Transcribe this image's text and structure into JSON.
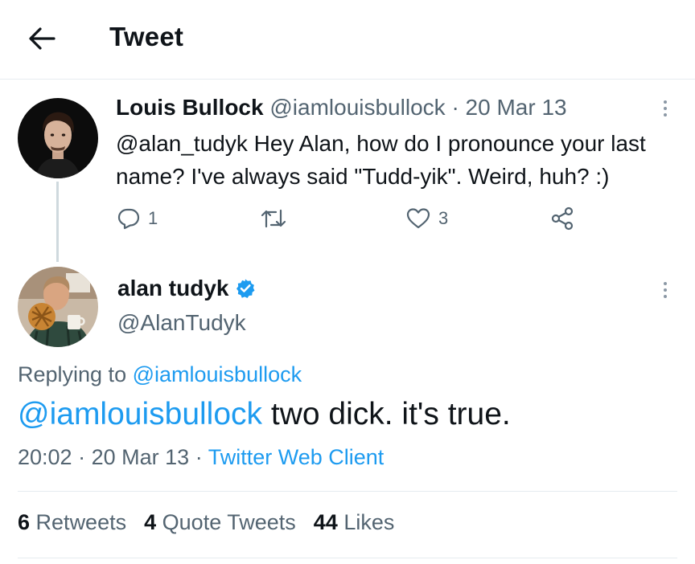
{
  "header": {
    "title": "Tweet"
  },
  "reply_tweet": {
    "author_name": "Louis Bullock",
    "handle": "@iamlouisbullock",
    "separator": "·",
    "date": "20 Mar 13",
    "text": "@alan_tudyk Hey Alan, how do I pronounce your last name? I've always said \"Tudd-yik\". Weird, huh? :)",
    "reply_count": "1",
    "like_count": "3"
  },
  "main_tweet": {
    "author_name": "alan tudyk",
    "handle": "@AlanTudyk",
    "replying_prefix": "Replying to",
    "replying_handle": "@iamlouisbullock",
    "mention": "@iamlouisbullock",
    "text": " two dick. it's true.",
    "time": "20:02",
    "separator": "·",
    "date": "20 Mar 13",
    "source": "Twitter Web Client"
  },
  "stats": {
    "retweets_count": "6",
    "retweets_label": "Retweets",
    "quotes_count": "4",
    "quotes_label": "Quote Tweets",
    "likes_count": "44",
    "likes_label": "Likes"
  },
  "colors": {
    "link": "#1d9bf0",
    "muted": "#536471",
    "text": "#0f1419",
    "divider": "#e6ecf0",
    "verified": "#1d9bf0"
  },
  "icons": [
    "back-arrow-icon",
    "more-icon",
    "reply-icon",
    "retweet-icon",
    "like-icon",
    "share-icon",
    "verified-badge-icon"
  ]
}
